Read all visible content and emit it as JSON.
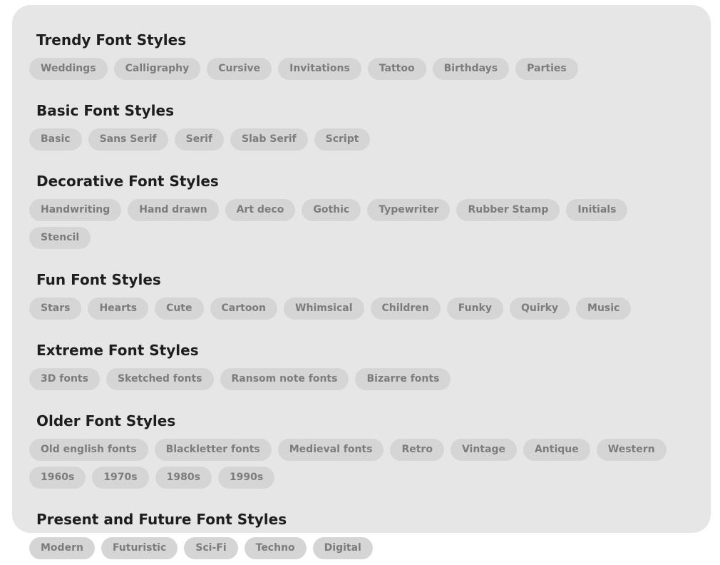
{
  "sections": [
    {
      "title": "Trendy Font Styles",
      "tags": [
        "Weddings",
        "Calligraphy",
        "Cursive",
        "Invitations",
        "Tattoo",
        "Birthdays",
        "Parties"
      ]
    },
    {
      "title": "Basic Font Styles",
      "tags": [
        "Basic",
        "Sans Serif",
        "Serif",
        "Slab Serif",
        "Script"
      ]
    },
    {
      "title": "Decorative Font Styles",
      "tags": [
        "Handwriting",
        "Hand drawn",
        "Art deco",
        "Gothic",
        "Typewriter",
        "Rubber Stamp",
        "Initials",
        "Stencil"
      ]
    },
    {
      "title": "Fun Font Styles",
      "tags": [
        "Stars",
        "Hearts",
        "Cute",
        "Cartoon",
        "Whimsical",
        "Children",
        "Funky",
        "Quirky",
        "Music"
      ]
    },
    {
      "title": "Extreme Font Styles",
      "tags": [
        "3D fonts",
        "Sketched fonts",
        "Ransom note fonts",
        "Bizarre fonts"
      ]
    },
    {
      "title": "Older Font Styles",
      "tags": [
        "Old english fonts",
        "Blackletter fonts",
        "Medieval fonts",
        "Retro",
        "Vintage",
        "Antique",
        "Western",
        "1960s",
        "1970s",
        "1980s",
        "1990s"
      ]
    },
    {
      "title": "Present and Future Font Styles",
      "tags": [
        "Modern",
        "Futuristic",
        "Sci-Fi",
        "Techno",
        "Digital"
      ]
    }
  ]
}
